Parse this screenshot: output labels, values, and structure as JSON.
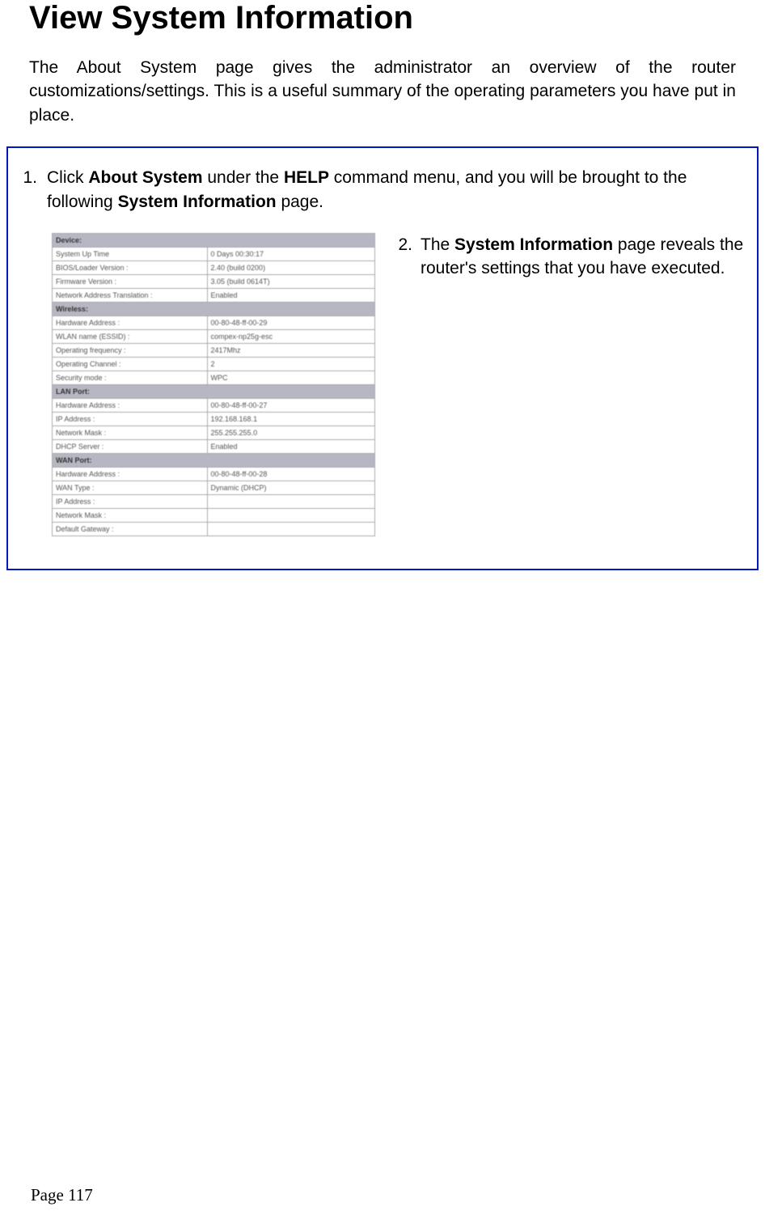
{
  "heading": "View System Information",
  "intro": "The About System page gives the administrator an overview of the router customizations/settings. This is a useful summary of the operating parameters you have put in place.",
  "step1": {
    "num": "1.",
    "pre": "Click ",
    "b1": "About System",
    "mid1": " under the ",
    "b2": "HELP",
    "mid2": " command menu, and you will be brought to the following ",
    "b3": "System Information",
    "post": " page."
  },
  "step2": {
    "num": "2.",
    "pre": "The ",
    "b1": "System Information",
    "post": " page reveals the router's settings that you have executed."
  },
  "table": {
    "device": {
      "header": "Device:",
      "rows": [
        {
          "label": "System Up Time",
          "value": "0 Days 00:30:17"
        },
        {
          "label": "BIOS/Loader Version :",
          "value": "2.40 (build 0200)"
        },
        {
          "label": "Firmware Version :",
          "value": "3.05 (build 0614T)"
        },
        {
          "label": "Network Address Translation :",
          "value": "Enabled"
        }
      ]
    },
    "wireless": {
      "header": "Wireless:",
      "rows": [
        {
          "label": "Hardware Address :",
          "value": "00-80-48-ff-00-29"
        },
        {
          "label": "WLAN name (ESSID) :",
          "value": "compex-np25g-esc"
        },
        {
          "label": "Operating frequency :",
          "value": "2417Mhz"
        },
        {
          "label": "Operating Channel :",
          "value": "2"
        },
        {
          "label": "Security mode :",
          "value": "WPC"
        }
      ]
    },
    "lan": {
      "header": "LAN Port:",
      "rows": [
        {
          "label": "Hardware Address :",
          "value": "00-80-48-ff-00-27"
        },
        {
          "label": "IP Address :",
          "value": "192.168.168.1"
        },
        {
          "label": "Network Mask :",
          "value": "255.255.255.0"
        },
        {
          "label": "DHCP Server :",
          "value": "Enabled"
        }
      ]
    },
    "wan": {
      "header": "WAN Port:",
      "rows": [
        {
          "label": "Hardware Address :",
          "value": "00-80-48-ff-00-28"
        },
        {
          "label": "WAN Type :",
          "value": "Dynamic (DHCP)"
        },
        {
          "label": "IP Address :",
          "value": ""
        },
        {
          "label": "Network Mask :",
          "value": ""
        },
        {
          "label": "Default Gateway :",
          "value": ""
        }
      ]
    }
  },
  "pageNum": "Page 117"
}
